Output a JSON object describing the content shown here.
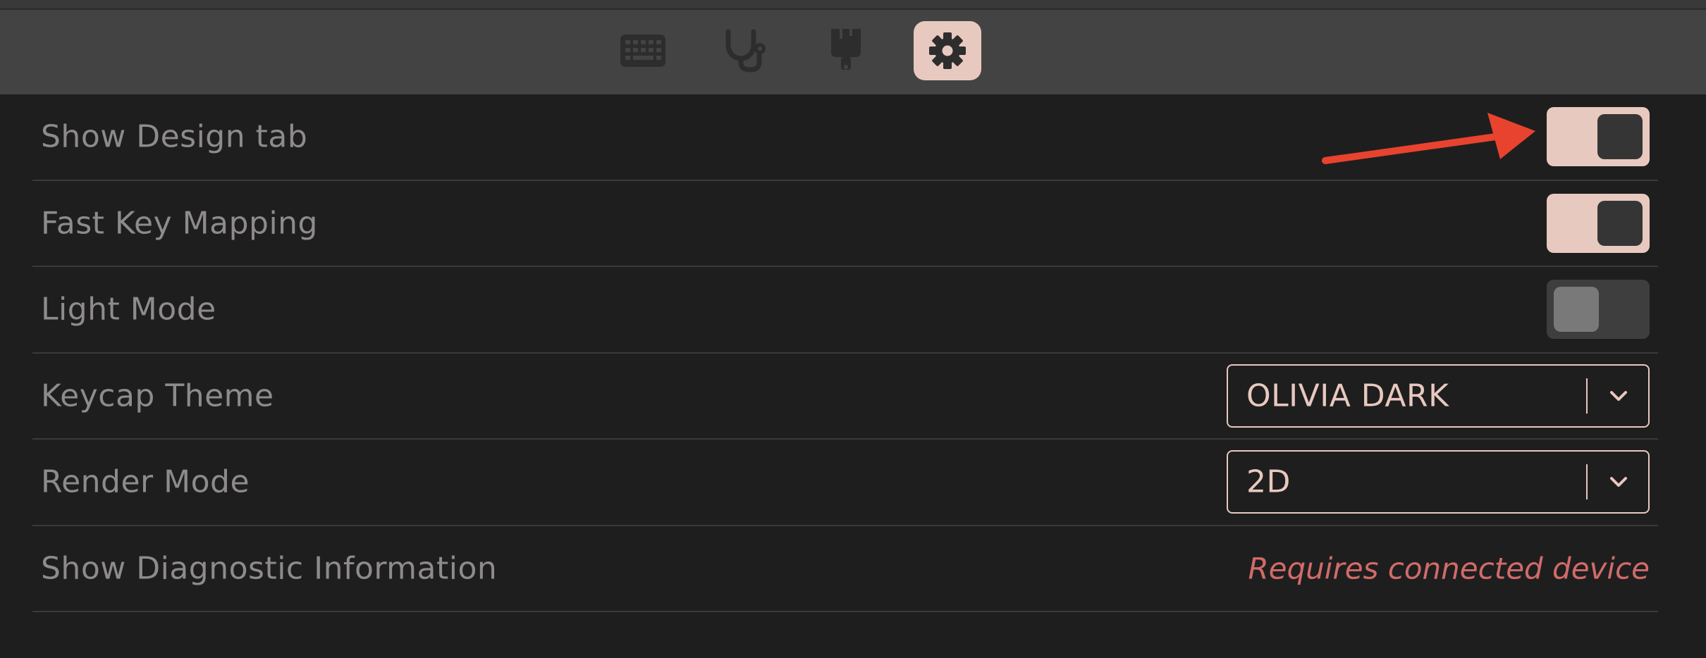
{
  "tabs": [
    {
      "icon": "keyboard-icon",
      "active": false
    },
    {
      "icon": "stethoscope-icon",
      "active": false
    },
    {
      "icon": "paintbrush-icon",
      "active": false
    },
    {
      "icon": "gear-icon",
      "active": true
    }
  ],
  "settings": {
    "show_design_tab": {
      "label": "Show Design tab",
      "toggle_on": true
    },
    "fast_key_mapping": {
      "label": "Fast Key Mapping",
      "toggle_on": true
    },
    "light_mode": {
      "label": "Light Mode",
      "toggle_on": false
    },
    "keycap_theme": {
      "label": "Keycap Theme",
      "value": "OLIVIA DARK"
    },
    "render_mode": {
      "label": "Render Mode",
      "value": "2D"
    },
    "show_diagnostic": {
      "label": "Show Diagnostic Information",
      "note": "Requires connected device"
    }
  },
  "colors": {
    "accent": "#e8c9bf",
    "warning_text": "#d16b69",
    "annotation_arrow": "#e8432e"
  }
}
